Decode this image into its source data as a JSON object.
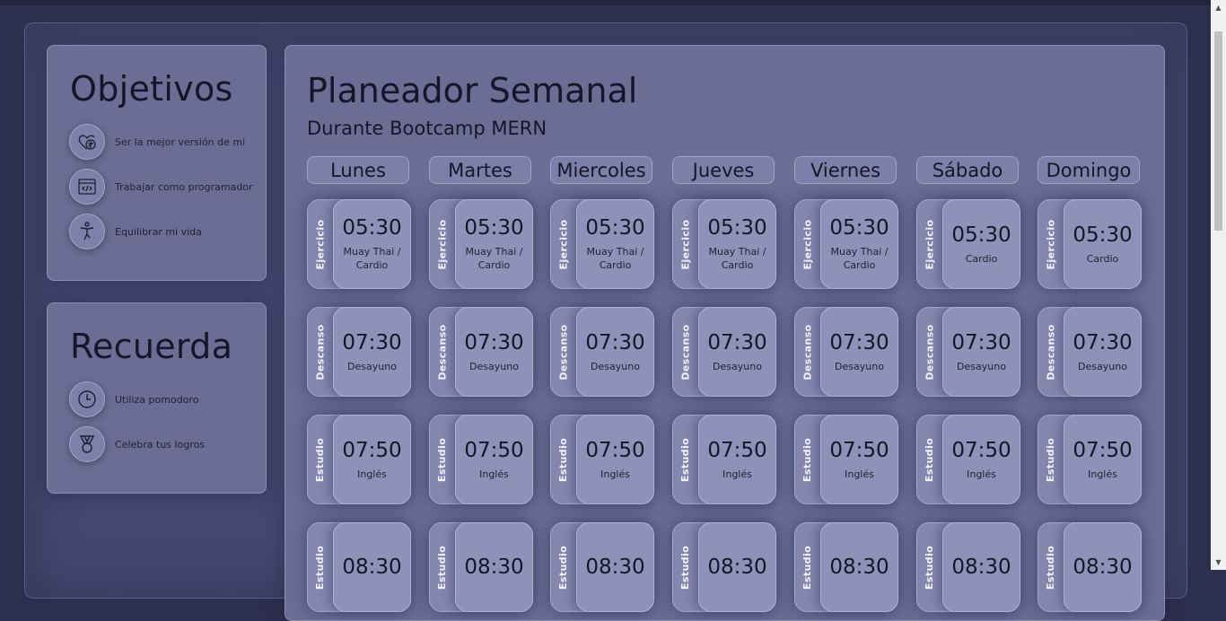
{
  "objetivos": {
    "title": "Objetivos",
    "items": [
      {
        "label": "Ser la mejor versión de mi",
        "icon": "brain-heart-icon"
      },
      {
        "label": "Trabajar como programador",
        "icon": "code-window-icon"
      },
      {
        "label": "Equilibrar mi vida",
        "icon": "balance-person-icon"
      }
    ]
  },
  "recuerda": {
    "title": "Recuerda",
    "items": [
      {
        "label": "Utiliza pomodoro",
        "icon": "clock-icon"
      },
      {
        "label": "Celebra tus logros",
        "icon": "medal-icon"
      }
    ]
  },
  "planner": {
    "title": "Planeador Semanal",
    "subtitle": "Durante Bootcamp MERN",
    "days": [
      "Lunes",
      "Martes",
      "Miercoles",
      "Jueves",
      "Viernes",
      "Sábado",
      "Domingo"
    ],
    "rows": [
      {
        "category": "Ejercicio",
        "time": "05:30",
        "activities": [
          "Muay Thai / Cardio",
          "Muay Thai / Cardio",
          "Muay Thai / Cardio",
          "Muay Thai / Cardio",
          "Muay Thai / Cardio",
          "Cardio",
          "Cardio"
        ]
      },
      {
        "category": "Descanso",
        "time": "07:30",
        "activities": [
          "Desayuno",
          "Desayuno",
          "Desayuno",
          "Desayuno",
          "Desayuno",
          "Desayuno",
          "Desayuno"
        ]
      },
      {
        "category": "Estudio",
        "time": "07:50",
        "activities": [
          "Inglés",
          "Inglés",
          "Inglés",
          "Inglés",
          "Inglés",
          "Inglés",
          "Inglés"
        ]
      },
      {
        "category": "Estudio",
        "time": "08:30",
        "activities": [
          "",
          "",
          "",
          "",
          "",
          "",
          ""
        ]
      }
    ]
  },
  "colors": {
    "background": "#2d2f4e",
    "card": "#6b6d94",
    "slot": "#8f92b8",
    "text": "#14162a"
  }
}
